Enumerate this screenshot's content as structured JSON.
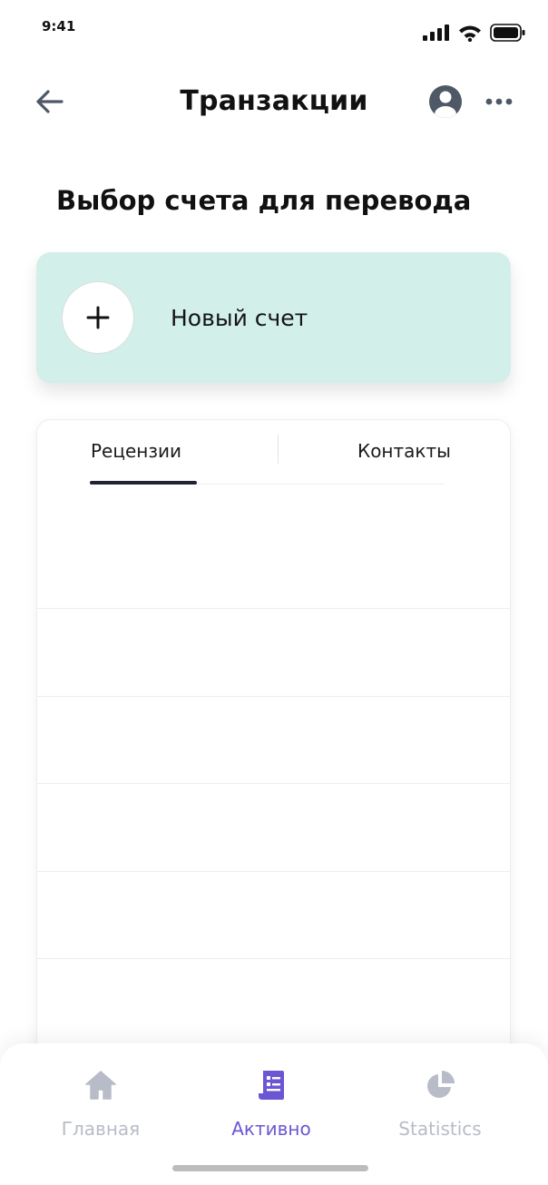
{
  "status_bar": {
    "time": "9:41",
    "icons": [
      "signal-icon",
      "wifi-icon",
      "battery-icon"
    ]
  },
  "header": {
    "title": "Транзакции",
    "icons": [
      "back-arrow-icon",
      "profile-icon",
      "more-dots-icon"
    ]
  },
  "section": {
    "title": "Выбор счета для перевода"
  },
  "new_account": {
    "label": "Новый счет",
    "icon": "plus-icon",
    "background": "#d2efe9"
  },
  "tabs": {
    "items": [
      {
        "label": "Рецензии",
        "active": true
      },
      {
        "label": "Контакты",
        "active": false
      }
    ],
    "indicator_color": "#1f2430"
  },
  "bottom_nav": {
    "items": [
      {
        "label": "Главная",
        "icon": "home-icon",
        "active": false
      },
      {
        "label": "Активно",
        "icon": "document-list-icon",
        "active": true
      },
      {
        "label": "Statistics",
        "icon": "pie-chart-icon",
        "active": false
      }
    ],
    "active_color": "#6c56d4",
    "inactive_color": "#b7bcc8"
  }
}
